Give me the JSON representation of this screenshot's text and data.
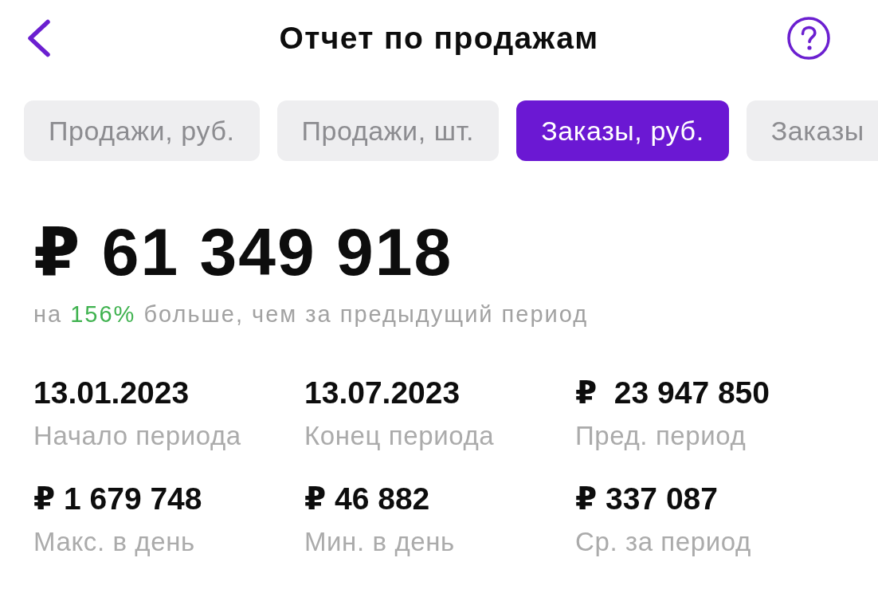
{
  "header": {
    "title": "Отчет по продажам"
  },
  "tabs": [
    {
      "label": "Продажи, руб.",
      "selected": false
    },
    {
      "label": "Продажи, шт.",
      "selected": false
    },
    {
      "label": "Заказы, руб.",
      "selected": true
    },
    {
      "label": "Заказы",
      "selected": false
    }
  ],
  "summary": {
    "amount": "₽ 61 349 918",
    "comparison": {
      "prefix": "на",
      "change": "156%",
      "positive": true,
      "suffix": "больше, чем за предыдущий период"
    }
  },
  "stats": [
    {
      "value": "13.01.2023",
      "label": "Начало периода"
    },
    {
      "value": "13.07.2023",
      "label": "Конец периода"
    },
    {
      "value": "₽  23 947 850",
      "label": "Пред. период"
    },
    {
      "value": "₽ 1 679 748",
      "label": "Макс. в день"
    },
    {
      "value": "₽ 46 882",
      "label": "Мин. в день"
    },
    {
      "value": "₽ 337 087",
      "label": "Ср. за период"
    }
  ]
}
